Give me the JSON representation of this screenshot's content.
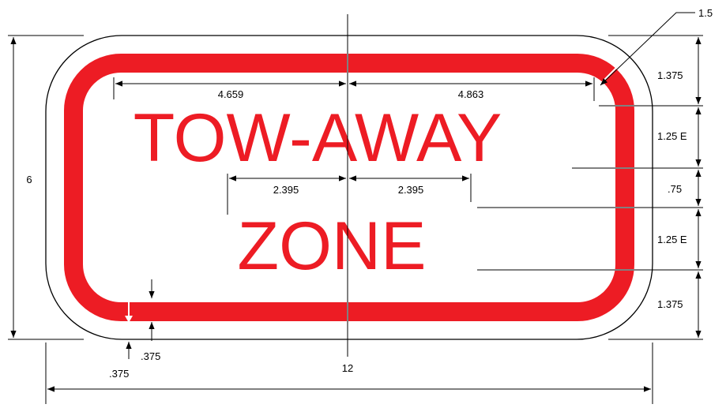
{
  "sign": {
    "line1": "TOW-AWAY",
    "line2": "ZONE",
    "legend_color": "#ed1c24",
    "border_color": "#ed1c24",
    "background_color": "#ffffff"
  },
  "dimensions": {
    "corner_radius": "1.5",
    "top_margin": "1.375",
    "line1_height": "1.25 E",
    "line_gap": ".75",
    "line2_height": "1.25 E",
    "bottom_margin": "1.375",
    "overall_height": "6",
    "overall_width": "12",
    "line1_left_half": "4.659",
    "line1_right_half": "4.863",
    "line2_left_half": "2.395",
    "line2_right_half": "2.395",
    "border_width": ".375",
    "border_inset": ".375"
  }
}
